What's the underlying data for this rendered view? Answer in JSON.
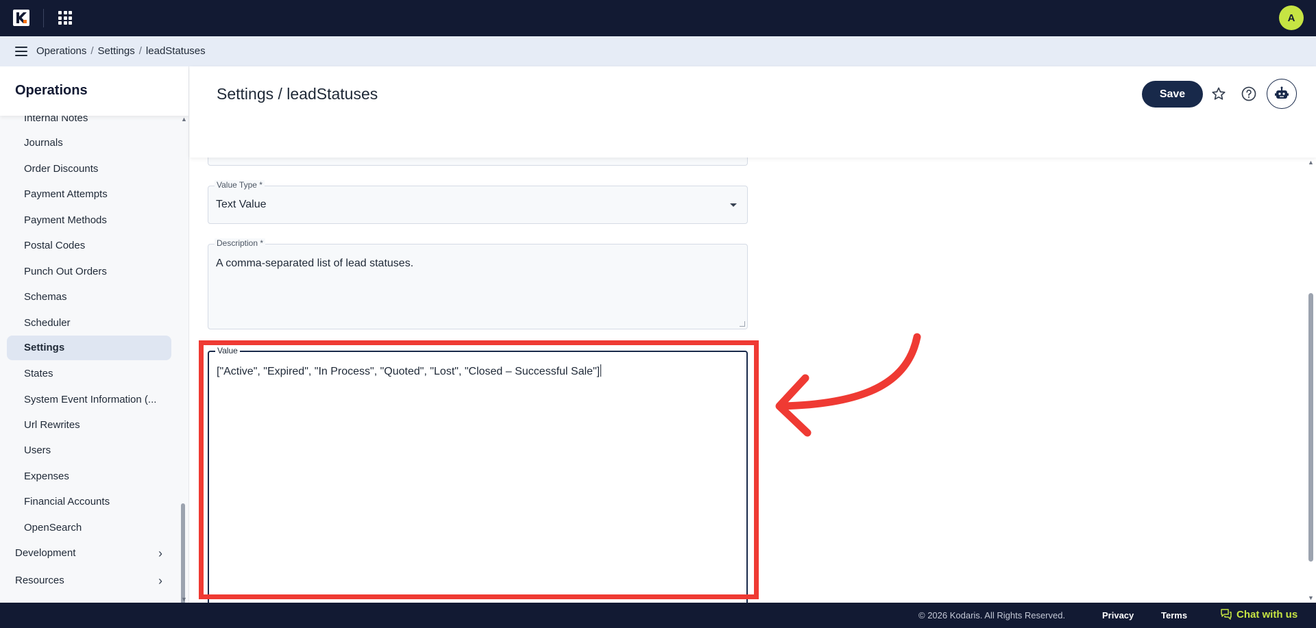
{
  "topbar": {
    "logo_icon": "kodaris-logo-icon",
    "apps_icon": "apps-grid-icon",
    "avatar_initial": "A",
    "avatar_color": "#c6e443"
  },
  "breadcrumb": {
    "items": [
      "Operations",
      "Settings",
      "leadStatuses"
    ],
    "separator": "/"
  },
  "sidebar": {
    "title": "Operations",
    "items": [
      {
        "label": "Internal Notes"
      },
      {
        "label": "Journals"
      },
      {
        "label": "Order Discounts"
      },
      {
        "label": "Payment Attempts"
      },
      {
        "label": "Payment Methods"
      },
      {
        "label": "Postal Codes"
      },
      {
        "label": "Punch Out Orders"
      },
      {
        "label": "Schemas"
      },
      {
        "label": "Scheduler"
      },
      {
        "label": "Settings",
        "active": true
      },
      {
        "label": "States"
      },
      {
        "label": "System Event Information (..."
      },
      {
        "label": "Url Rewrites"
      },
      {
        "label": "Users"
      },
      {
        "label": "Expenses"
      },
      {
        "label": "Financial Accounts"
      },
      {
        "label": "OpenSearch"
      }
    ],
    "groups": [
      {
        "label": "Development"
      },
      {
        "label": "Resources"
      }
    ]
  },
  "header": {
    "title": "Settings / leadStatuses",
    "save_label": "Save",
    "star_icon": "star-icon",
    "help_icon": "help-icon",
    "bot_icon": "assistant-bot-icon",
    "accent_color": "#18294a"
  },
  "form": {
    "value_type": {
      "label": "Value Type *",
      "value": "Text Value"
    },
    "description": {
      "label": "Description *",
      "value": "A comma-separated list of lead statuses."
    },
    "value": {
      "label": "Value",
      "value": "[\"Active\", \"Expired\", \"In Process\", \"Quoted\", \"Lost\", \"Closed – Successful Sale\"]"
    }
  },
  "annotation": {
    "color": "#ef3a33"
  },
  "footer": {
    "copyright": "© 2026 Kodaris. All Rights Reserved.",
    "privacy": "Privacy",
    "terms": "Terms",
    "chat": "Chat with us",
    "chat_color": "#c6e443"
  }
}
